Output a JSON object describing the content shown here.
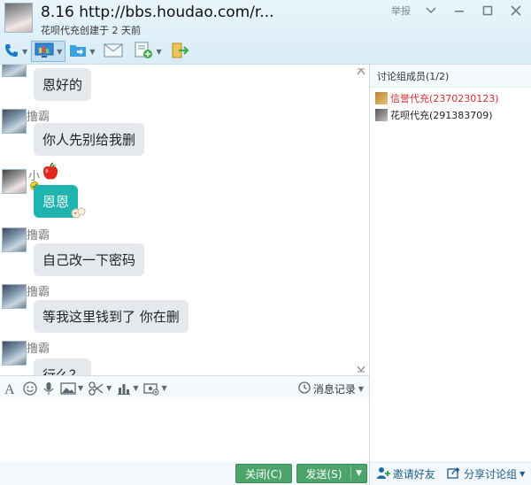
{
  "header": {
    "title": "8.16 http://bbs.houdao.com/r...",
    "subtitle": "花呗代充创建于 2 天前",
    "report": "举报"
  },
  "chat": {
    "messages": [
      {
        "sender": "",
        "text": "恩好的",
        "side": "them"
      },
      {
        "sender": "撸霸",
        "text": "你人先别给我删",
        "side": "them"
      },
      {
        "sender": "小",
        "text": "恩恩",
        "side": "me"
      },
      {
        "sender": "撸霸",
        "text": "自己改一下密码",
        "side": "them"
      },
      {
        "sender": "撸霸",
        "text": "等我这里钱到了 你在删",
        "side": "them"
      },
      {
        "sender": "撸霸",
        "text": "行么？",
        "side": "them"
      }
    ]
  },
  "input_toolbar": {
    "history": "消息记录"
  },
  "buttons": {
    "close": "关闭(C)",
    "send": "发送(S)"
  },
  "members": {
    "header": "讨论组成员(1/2)",
    "items": [
      {
        "name": "信誉代充(2370230123)",
        "role": "owner"
      },
      {
        "name": "花呗代充(291383709)",
        "role": "member"
      }
    ],
    "invite": "邀请好友",
    "share": "分享讨论组"
  },
  "colors": {
    "send_button": "#4da46b",
    "teal_bubble": "#1eb5b0",
    "owner_name": "#d32e2e"
  }
}
